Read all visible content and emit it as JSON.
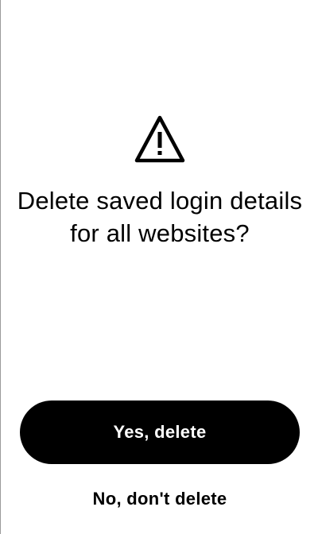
{
  "dialog": {
    "icon": "warning-icon",
    "title": "Delete saved login details for all websites?",
    "confirm_label": "Yes, delete",
    "cancel_label": "No, don't delete"
  },
  "colors": {
    "background": "#ffffff",
    "text": "#000000",
    "primary_button_bg": "#000000",
    "primary_button_text": "#ffffff"
  }
}
